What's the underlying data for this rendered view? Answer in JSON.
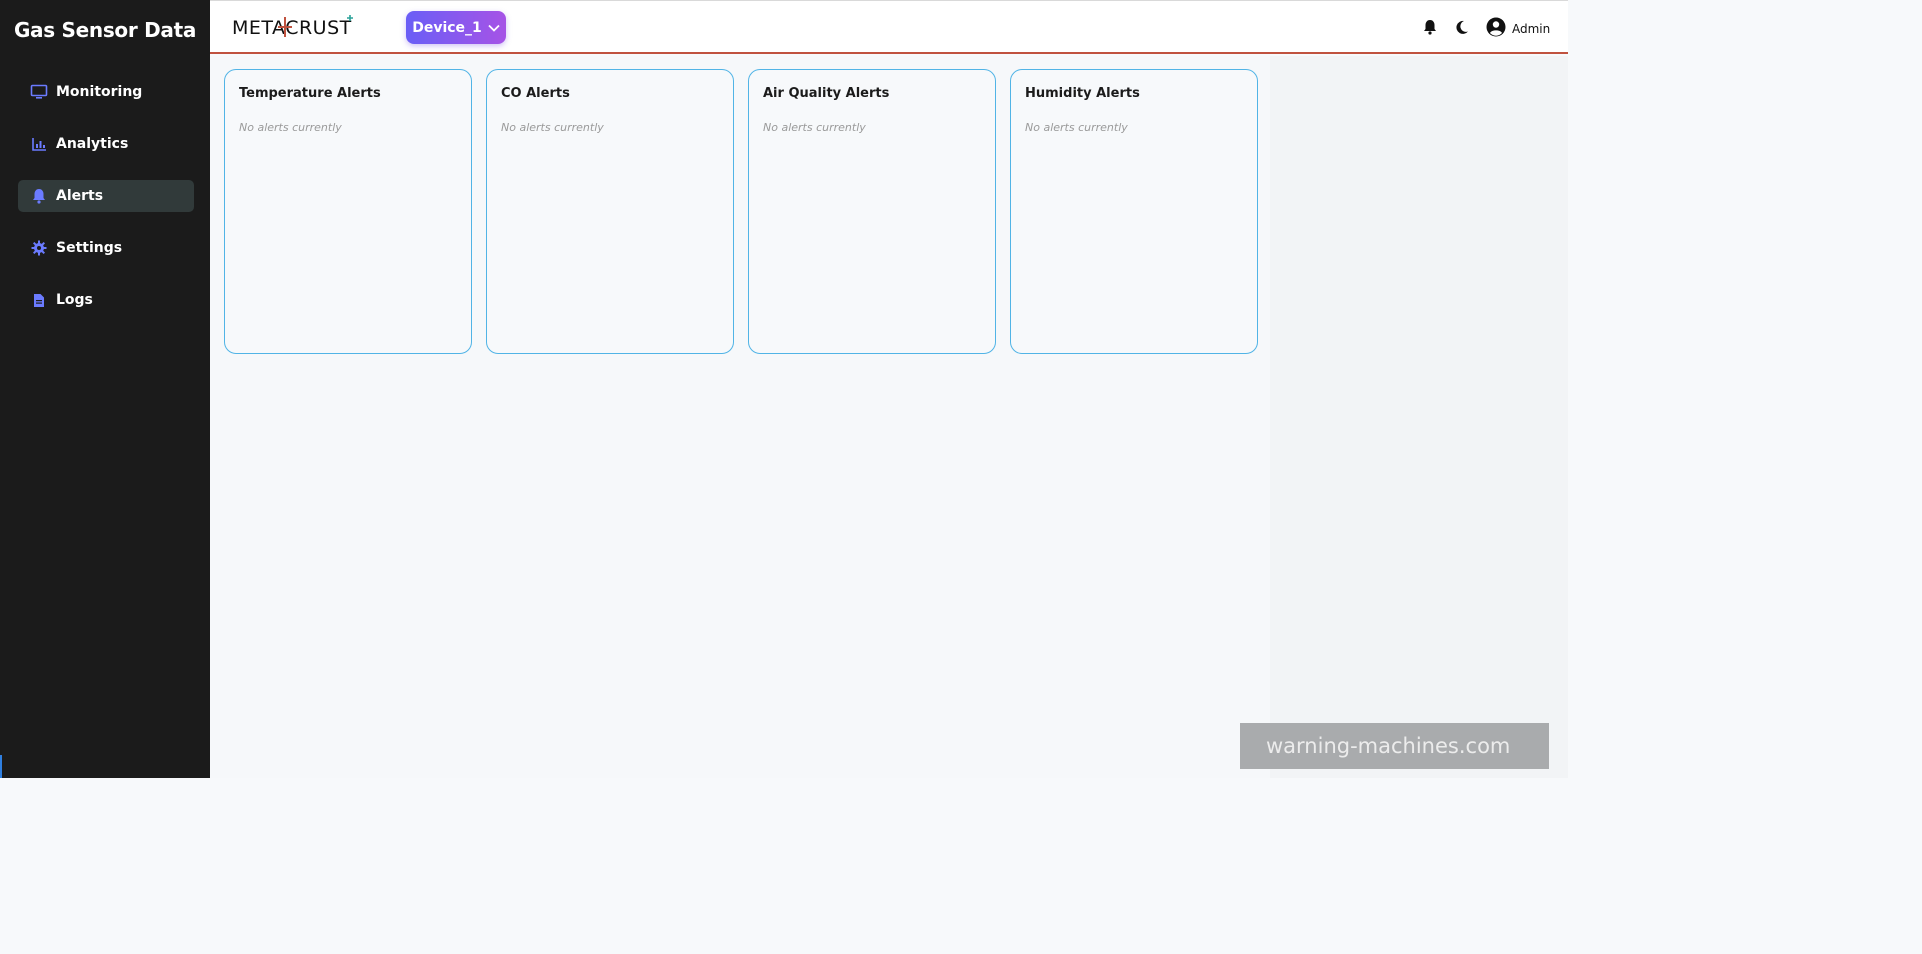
{
  "app": {
    "title": "Gas Sensor Data"
  },
  "sidebar": {
    "items": [
      {
        "label": "Monitoring",
        "icon": "monitor-icon",
        "active": false
      },
      {
        "label": "Analytics",
        "icon": "bar-chart-icon",
        "active": false
      },
      {
        "label": "Alerts",
        "icon": "bell-icon",
        "active": true
      },
      {
        "label": "Settings",
        "icon": "gear-icon",
        "active": false
      },
      {
        "label": "Logs",
        "icon": "file-icon",
        "active": false
      }
    ]
  },
  "header": {
    "logo_text": "METACRUST",
    "device_select": {
      "value": "Device_1"
    },
    "notification_icon": "bell-icon",
    "theme_icon": "moon-icon",
    "user": {
      "name": "Admin",
      "icon": "user-circle-icon"
    }
  },
  "alerts": {
    "cards": [
      {
        "title": "Temperature Alerts",
        "empty_text": "No alerts currently"
      },
      {
        "title": "CO Alerts",
        "empty_text": "No alerts currently"
      },
      {
        "title": "Air Quality Alerts",
        "empty_text": "No alerts currently"
      },
      {
        "title": "Humidity Alerts",
        "empty_text": "No alerts currently"
      }
    ]
  },
  "watermark": {
    "text": "warning-machines.com"
  },
  "colors": {
    "sidebar_bg": "#1b1b1b",
    "accent_icon": "#6b7bff",
    "card_border": "#51b4e6",
    "header_rule": "#c0523f",
    "device_gradient_start": "#6a5ef6",
    "device_gradient_end": "#a653e6"
  }
}
